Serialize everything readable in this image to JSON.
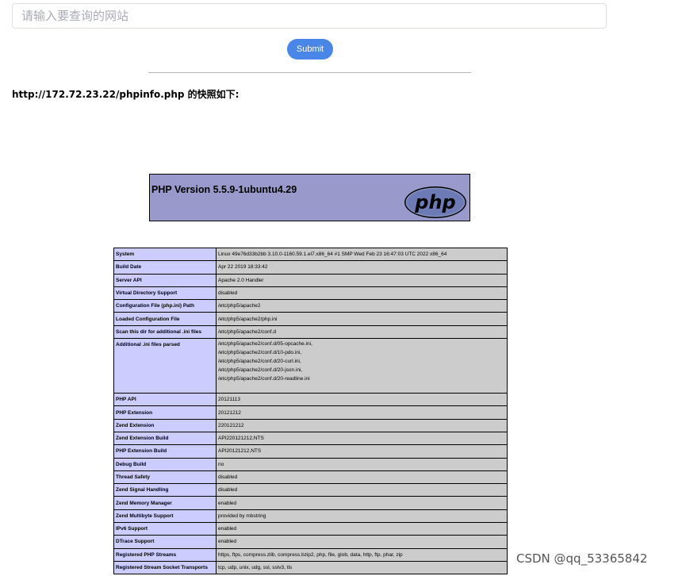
{
  "search": {
    "placeholder": "请输入要查询的网站",
    "value": ""
  },
  "submit_label": "Submit",
  "snapshot_label": "http://172.72.23.22/phpinfo.php 的快照如下:",
  "php": {
    "version_title": "PHP Version 5.5.9-1ubuntu4.29",
    "logo_text": "php",
    "colors": {
      "header_bg": "#9999cc",
      "key_bg": "#ccccff",
      "value_bg": "#cccccc"
    },
    "rows": [
      {
        "key": "System",
        "value": "Linux 49e76d33b2bb 3.10.0-1160.59.1.el7.x86_64 #1 SMP Wed Feb 23 16:47:03 UTC 2022 x86_64"
      },
      {
        "key": "Build Date",
        "value": "Apr 22 2019 18:33:42"
      },
      {
        "key": "Server API",
        "value": "Apache 2.0 Handler"
      },
      {
        "key": "Virtual Directory Support",
        "value": "disabled"
      },
      {
        "key": "Configuration File (php.ini) Path",
        "value": "/etc/php5/apache2"
      },
      {
        "key": "Loaded Configuration File",
        "value": "/etc/php5/apache2/php.ini"
      },
      {
        "key": "Scan this dir for additional .ini files",
        "value": "/etc/php5/apache2/conf.d"
      },
      {
        "key": "Additional .ini files parsed",
        "values": [
          "/etc/php5/apache2/conf.d/05-opcache.ini,",
          "/etc/php5/apache2/conf.d/10-pdo.ini,",
          "/etc/php5/apache2/conf.d/20-curl.ini,",
          "/etc/php5/apache2/conf.d/20-json.ini,",
          "/etc/php5/apache2/conf.d/20-readline.ini"
        ]
      },
      {
        "key": "PHP API",
        "value": "20121113"
      },
      {
        "key": "PHP Extension",
        "value": "20121212"
      },
      {
        "key": "Zend Extension",
        "value": "220121212"
      },
      {
        "key": "Zend Extension Build",
        "value": "API220121212,NTS"
      },
      {
        "key": "PHP Extension Build",
        "value": "API20121212,NTS"
      },
      {
        "key": "Debug Build",
        "value": "no"
      },
      {
        "key": "Thread Safety",
        "value": "disabled"
      },
      {
        "key": "Zend Signal Handling",
        "value": "disabled"
      },
      {
        "key": "Zend Memory Manager",
        "value": "enabled"
      },
      {
        "key": "Zend Multibyte Support",
        "value": "provided by mbstring"
      },
      {
        "key": "IPv6 Support",
        "value": "enabled"
      },
      {
        "key": "DTrace Support",
        "value": "enabled"
      },
      {
        "key": "Registered PHP Streams",
        "value": "https, ftps, compress.zlib, compress.bzip2, php, file, glob, data, http, ftp, phar, zip"
      },
      {
        "key": "Registered Stream Socket Transports",
        "value": "tcp, udp, unix, udg, ssl, sslv3, tls"
      }
    ]
  },
  "watermark": "CSDN @qq_53365842"
}
